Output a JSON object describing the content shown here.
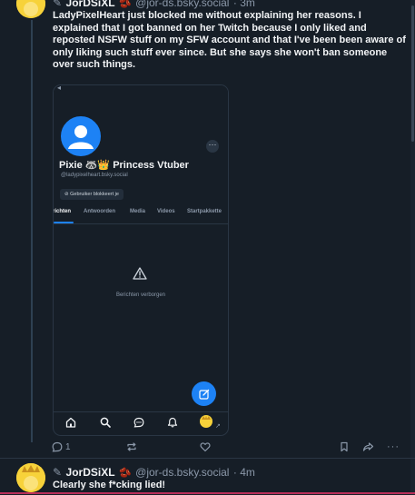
{
  "post1": {
    "display_name": "JorDSiXL",
    "handle": "@jor-ds.bsky.social",
    "time": "· 3m",
    "text": "LadyPixelHeart just blocked me without explaining her reasons. I explained that I got banned on her Twitch because I only liked and reposted NSFW stuff on my SFW account and that I've been been aware of only liking such stuff ever since. But she says she won't ban someone over such things.",
    "embed": {
      "display_name": "Pixie 🦝👑 Princess Vtuber",
      "handle": "@ladypixelheart.bsky.social",
      "blocked_label": "Gebruiker blokkeert je",
      "tabs": [
        "richten",
        "Antwoorden",
        "Media",
        "Videos",
        "Startpakkette"
      ],
      "hidden_message": "Berichten verborgen",
      "more": "···"
    },
    "actions": {
      "reply_count": "1",
      "like_count": ""
    }
  },
  "post2": {
    "display_name": "JorDSiXL",
    "handle": "@jor-ds.bsky.social",
    "time": "· 4m",
    "text": "Clearly she f*cking lied!"
  },
  "colors": {
    "background": "#161e27",
    "accent": "#1d82f5",
    "muted": "#8b98a9",
    "avatar": "#f7d23a"
  },
  "icons": [
    "home-icon",
    "search-icon",
    "chat-icon",
    "bell-icon",
    "profile-icon",
    "compose-icon",
    "reply-icon",
    "repost-icon",
    "like-icon",
    "bookmark-icon",
    "share-icon",
    "more-icon",
    "warning-icon",
    "block-icon"
  ]
}
